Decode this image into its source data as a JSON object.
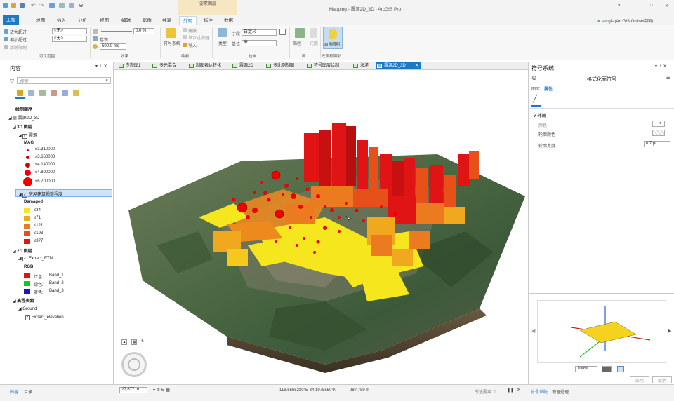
{
  "titlebar": {
    "title": "Mapping - 震源2D_3D - ArcGIS Pro",
    "context_tab": "要素图层",
    "user": "arcgis (ArcGIS Online中国)",
    "help": "?",
    "minimize": "—",
    "maximize": "□",
    "close": "✕"
  },
  "ribbon_tabs": [
    "工程",
    "地图",
    "插入",
    "分析",
    "视图",
    "编辑",
    "影像",
    "共享",
    "外观",
    "标注",
    "数据"
  ],
  "ribbon": {
    "zoom_in_label": "放大超过",
    "zoom_out_label": "缩小超过",
    "clear_label": "清除限制",
    "zoom_in_value": "<无>",
    "zoom_out_value": "<无>",
    "percent_value": "0.0 %",
    "swipe_label": "卷帘",
    "duration_value": "500.0 ms",
    "visible_group": "可见范围",
    "effects_group": "效果",
    "symbology_label": "符号系统",
    "mask_label": "掩膜",
    "filter_label": "显示过滤器",
    "import_label": "导入",
    "draw_group": "绘制",
    "field_label": "字段",
    "field_value": "自定义",
    "type_label": "类型",
    "unit_label": "单位",
    "unit_value": "米",
    "extrude_group": "拉伸",
    "elevation_label": "高程",
    "lighting_label": "光照",
    "enable_lighting_label": "启用照明",
    "face_group": "面",
    "lighting_group": "光照和阴影"
  },
  "contents": {
    "title": "内容",
    "search_placeholder": "搜索",
    "drawing_order": "绘制顺序",
    "map_name": "震源2D_3D",
    "group_3d": "3D 图层",
    "layer_quake": "震源",
    "field_mag": "MAG",
    "mag_classes": [
      "≤3.310000",
      "≤3.660000",
      "≤4.140000",
      "≤4.890000",
      "≤6.700000"
    ],
    "layer_damage": "房屋建筑损毁程度",
    "field_damaged": "Damaged",
    "damage_classes": [
      "≤34",
      "≤71",
      "≤121",
      "≤193",
      "≤377"
    ],
    "damage_colors": [
      "#f5e61e",
      "#f0a81e",
      "#ec7a1e",
      "#e8501a",
      "#e01414"
    ],
    "group_2d": "2D 图层",
    "layer_etm": "Extract_ETM",
    "field_rgb": "RGB",
    "bands": [
      {
        "label": "红色:",
        "band": "Band_1",
        "color": "#e01414"
      },
      {
        "label": "绿色:",
        "band": "Band_2",
        "color": "#14c814"
      },
      {
        "label": "蓝色:",
        "band": "Band_3",
        "color": "#1414d2"
      }
    ],
    "group_elev": "高程表面",
    "ground": "Ground",
    "layer_elev": "Extract_elevation",
    "bottom_tabs": [
      "内容",
      "目录"
    ]
  },
  "map_tabs": [
    "专题图1",
    "多元混合",
    "制图表达转化",
    "震源2D",
    "多比例制图",
    "符号图层绘制",
    "海洋",
    "震源2D_3D"
  ],
  "symbology": {
    "title": "符号系统",
    "subtitle": "格式化面符号",
    "tab_gallery": "图库",
    "tab_properties": "属性",
    "section_outline": "外观",
    "color_label": "颜色",
    "outline_color_label": "轮廓颜色",
    "outline_width_label": "轮廓宽度",
    "outline_width_value": "0.7 pt",
    "zoom_value": "100%",
    "apply_button": "应用",
    "cancel_button": "取消",
    "bottom_tabs": [
      "符号系统",
      "地理处理"
    ]
  },
  "status": {
    "scale": "27,677 m",
    "coords": "118.6565230°E 34.1975550°N",
    "elevation": "987.789 m",
    "selected": "所选要素: 0"
  }
}
